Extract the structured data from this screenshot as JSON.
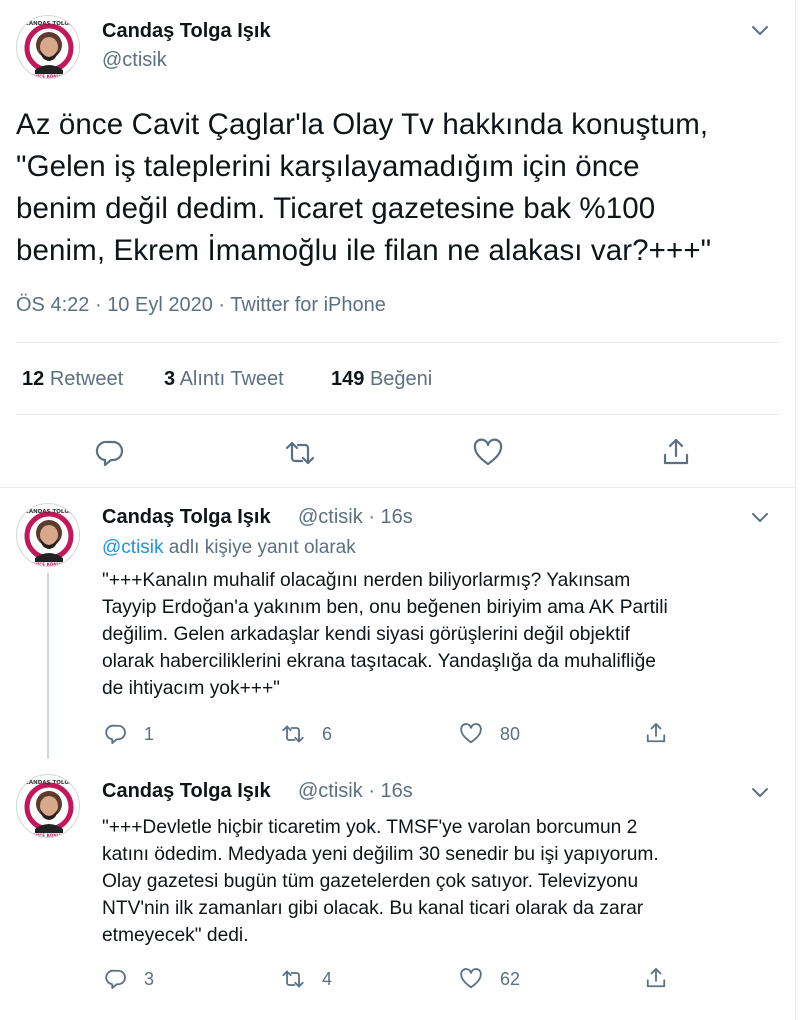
{
  "main_tweet": {
    "author_name": "Candaş Tolga Işık",
    "author_handle": "@ctisik",
    "avatar_text_top": "CANDAŞ TOLGA",
    "avatar_text_bottom": "AZ ÖNCE KONUŞTUM",
    "text": "Az önce Cavit Çaglar'la Olay Tv hakkında konuştum,\n\"Gelen iş taleplerini karşılayamadığım için önce\nbenim değil dedim. Ticaret gazetesine bak %100\nbenim, Ekrem İmamoğlu ile filan ne alakası var?+++\"",
    "time": "ÖS 4:22",
    "date": "10 Eyl 2020",
    "source": "Twitter for iPhone",
    "separator": "·",
    "retweets_count": "12",
    "retweets_label": "Retweet",
    "quotes_count": "3",
    "quotes_label": "Alıntı Tweet",
    "likes_count": "149",
    "likes_label": "Beğeni"
  },
  "replies": [
    {
      "author_name": "Candaş Tolga Işık",
      "author_handle": "@ctisik",
      "separator": "·",
      "age": "16s",
      "replying_to_handle": "@ctisik",
      "replying_to_suffix": " adlı kişiye yanıt olarak",
      "text": "\"+++Kanalın muhalif olacağını nerden biliyorlarmış? Yakınsam\nTayyip Erdoğan'a yakınım ben, onu beğenen biriyim ama AK Partili\ndeğilim. Gelen arkadaşlar kendi siyasi görüşlerini değil objektif\nolarak haberciliklerini ekrana taşıtacak. Yandaşlığa da muhalifliğe\nde ihtiyacım yok+++\"",
      "reply_count": "1",
      "retweet_count": "6",
      "like_count": "80"
    },
    {
      "author_name": "Candaş Tolga Işık",
      "author_handle": "@ctisik",
      "separator": "·",
      "age": "16s",
      "text": "\"+++Devletle hiçbir ticaretim yok. TMSF'ye varolan borcumun 2\nkatını ödedim. Medyada yeni değilim 30 senedir bu işi yapıyorum.\nOlay gazetesi bugün tüm gazetelerden çok satıyor. Televizyonu\nNTV'nin ilk zamanları gibi olacak. Bu kanal ticari olarak da zarar\netmeyecek\" dedi.",
      "reply_count": "3",
      "retweet_count": "4",
      "like_count": "62"
    }
  ],
  "colors": {
    "text_primary": "#0f1419",
    "text_secondary": "#5b7083",
    "link": "#1b95e0",
    "divider": "#e6ecf0",
    "avatar_ring": "#c2185b"
  },
  "icons": [
    "chevron-down-icon",
    "reply-icon",
    "retweet-icon",
    "like-icon",
    "share-icon"
  ]
}
